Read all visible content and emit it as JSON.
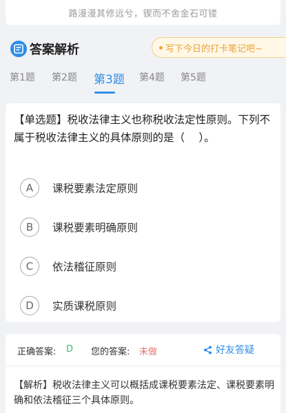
{
  "motto": "路漫漫其修远兮，锲而不舍金石可镂",
  "header": {
    "title": "答案解析",
    "note_button": "写下今日的打卡笔记吧~"
  },
  "tabs": [
    "第1题",
    "第2题",
    "第3题",
    "第4题",
    "第5题"
  ],
  "active_tab": "第3题",
  "question": {
    "text": "【单选题】税收法律主义也称税收法定性原则。下列不属于税收法律主义的具体原则的是（　 ）。",
    "options": [
      {
        "letter": "A",
        "text": "课税要素法定原则"
      },
      {
        "letter": "B",
        "text": "课税要素明确原则"
      },
      {
        "letter": "C",
        "text": "依法稽征原则"
      },
      {
        "letter": "D",
        "text": "实质课税原则"
      }
    ]
  },
  "answer": {
    "correct_label": "正确答案:",
    "correct_value": "D",
    "your_label": "您的答案:",
    "your_value": "未做",
    "share_label": "好友答疑"
  },
  "analysis": "【解析】税收法律主义可以概括成课税要素法定、课税要素明确和依法稽征三个具体原则。",
  "colors": {
    "accent": "#2f8ee6",
    "correct": "#3bb878",
    "not_done": "#e8746e",
    "note": "#e8a23a"
  }
}
